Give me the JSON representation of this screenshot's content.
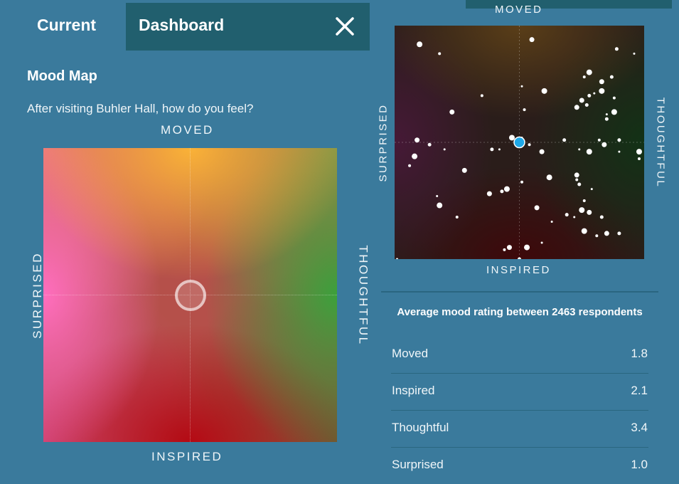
{
  "tabs": {
    "current": "Current",
    "dashboard": "Dashboard"
  },
  "icons": {
    "close": "close-icon"
  },
  "mood_map": {
    "title": "Mood Map",
    "question": "After visiting Buhler Hall, how do you feel?",
    "axes": {
      "top": "MOVED",
      "bottom": "INSPIRED",
      "left": "SURPRISED",
      "right": "THOUGHTFUL"
    }
  },
  "dashboard": {
    "axes": {
      "top": "MOVED",
      "bottom": "INSPIRED",
      "left": "SURPRISED",
      "right": "THOUGHTFUL"
    },
    "average_title": "Average mood rating between 2463 respondents",
    "ratings": [
      {
        "label": "Moved",
        "value": "1.8"
      },
      {
        "label": "Inspired",
        "value": "2.1"
      },
      {
        "label": "Thoughtful",
        "value": "3.4"
      },
      {
        "label": "Surprised",
        "value": "1.0"
      }
    ]
  },
  "chart_data": {
    "type": "scatter",
    "title": "",
    "xlabel": "",
    "ylabel": "",
    "xlim": [
      0,
      1
    ],
    "ylim": [
      0,
      1
    ],
    "highlight_point": {
      "x": 0.5,
      "y": 0.5,
      "color": "#1ea8e8"
    },
    "points": [
      [
        0.1,
        0.92
      ],
      [
        0.18,
        0.88
      ],
      [
        0.55,
        0.94
      ],
      [
        0.89,
        0.9
      ],
      [
        0.96,
        0.88
      ],
      [
        0.78,
        0.8
      ],
      [
        0.76,
        0.78
      ],
      [
        0.83,
        0.76
      ],
      [
        0.87,
        0.78
      ],
      [
        0.51,
        0.74
      ],
      [
        0.6,
        0.72
      ],
      [
        0.35,
        0.7
      ],
      [
        0.75,
        0.68
      ],
      [
        0.78,
        0.7
      ],
      [
        0.8,
        0.71
      ],
      [
        0.83,
        0.72
      ],
      [
        0.88,
        0.69
      ],
      [
        0.73,
        0.65
      ],
      [
        0.77,
        0.66
      ],
      [
        0.85,
        0.62
      ],
      [
        0.88,
        0.63
      ],
      [
        0.52,
        0.64
      ],
      [
        0.23,
        0.63
      ],
      [
        0.85,
        0.6
      ],
      [
        0.51,
        0.52
      ],
      [
        0.47,
        0.52
      ],
      [
        0.54,
        0.49
      ],
      [
        0.59,
        0.46
      ],
      [
        0.68,
        0.51
      ],
      [
        0.74,
        0.47
      ],
      [
        0.78,
        0.46
      ],
      [
        0.82,
        0.51
      ],
      [
        0.84,
        0.49
      ],
      [
        0.9,
        0.51
      ],
      [
        0.9,
        0.46
      ],
      [
        0.98,
        0.46
      ],
      [
        0.98,
        0.43
      ],
      [
        0.09,
        0.51
      ],
      [
        0.14,
        0.49
      ],
      [
        0.2,
        0.47
      ],
      [
        0.08,
        0.44
      ],
      [
        0.06,
        0.4
      ],
      [
        0.28,
        0.38
      ],
      [
        0.39,
        0.47
      ],
      [
        0.42,
        0.47
      ],
      [
        0.62,
        0.35
      ],
      [
        0.73,
        0.34
      ],
      [
        0.73,
        0.36
      ],
      [
        0.74,
        0.32
      ],
      [
        0.79,
        0.3
      ],
      [
        0.45,
        0.3
      ],
      [
        0.51,
        0.33
      ],
      [
        0.38,
        0.28
      ],
      [
        0.43,
        0.29
      ],
      [
        0.17,
        0.27
      ],
      [
        0.18,
        0.23
      ],
      [
        0.25,
        0.18
      ],
      [
        0.57,
        0.22
      ],
      [
        0.69,
        0.19
      ],
      [
        0.72,
        0.18
      ],
      [
        0.75,
        0.21
      ],
      [
        0.76,
        0.25
      ],
      [
        0.78,
        0.2
      ],
      [
        0.83,
        0.18
      ],
      [
        0.63,
        0.16
      ],
      [
        0.76,
        0.12
      ],
      [
        0.81,
        0.1
      ],
      [
        0.85,
        0.11
      ],
      [
        0.9,
        0.11
      ],
      [
        0.59,
        0.07
      ],
      [
        0.53,
        0.05
      ],
      [
        0.44,
        0.04
      ],
      [
        0.46,
        0.05
      ],
      [
        0.5,
        0.0
      ],
      [
        0.01,
        0.0
      ]
    ]
  }
}
